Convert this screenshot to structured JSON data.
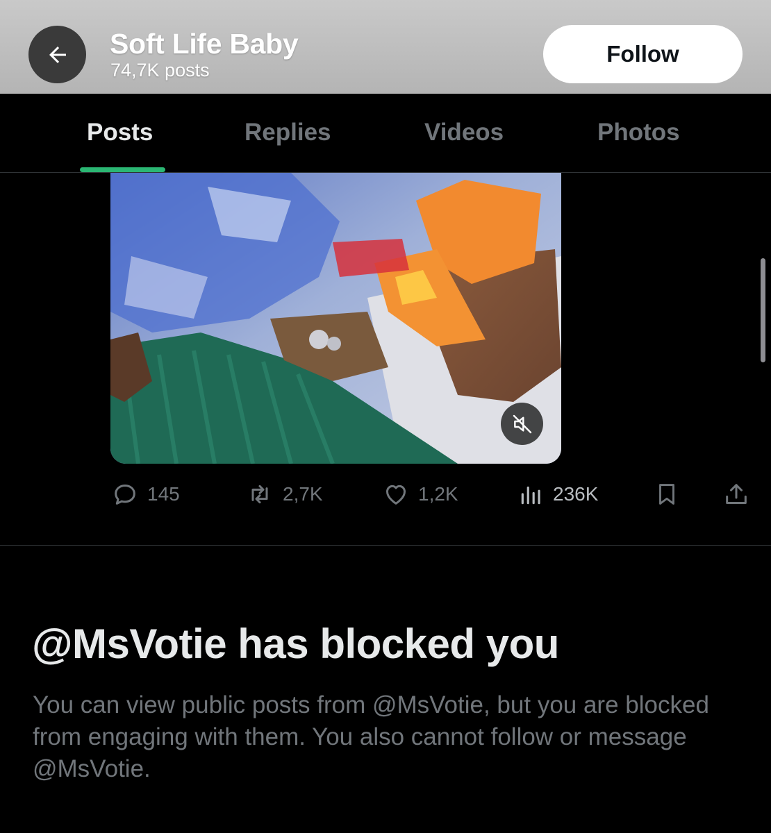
{
  "header": {
    "title": "Soft Life Baby",
    "post_count": "74,7K posts",
    "back_icon": "arrow-left-icon",
    "follow_label": "Follow"
  },
  "tabs": [
    {
      "label": "Posts",
      "active": true
    },
    {
      "label": "Replies",
      "active": false
    },
    {
      "label": "Videos",
      "active": false
    },
    {
      "label": "Photos",
      "active": false
    }
  ],
  "media": {
    "description_icon": "video-thumbnail",
    "mute_icon": "speaker-muted-icon"
  },
  "actions": {
    "replies": "145",
    "reposts": "2,7K",
    "likes": "1,2K",
    "views": "236K"
  },
  "blocked": {
    "title": "@MsVotie has blocked you",
    "description": "You can view public posts from @MsVotie, but you are blocked from engaging with them. You also cannot follow or message @MsVotie."
  },
  "colors": {
    "accent_underline": "#2bb673",
    "muted_text": "#71767b",
    "primary_text": "#e7e9ea"
  }
}
